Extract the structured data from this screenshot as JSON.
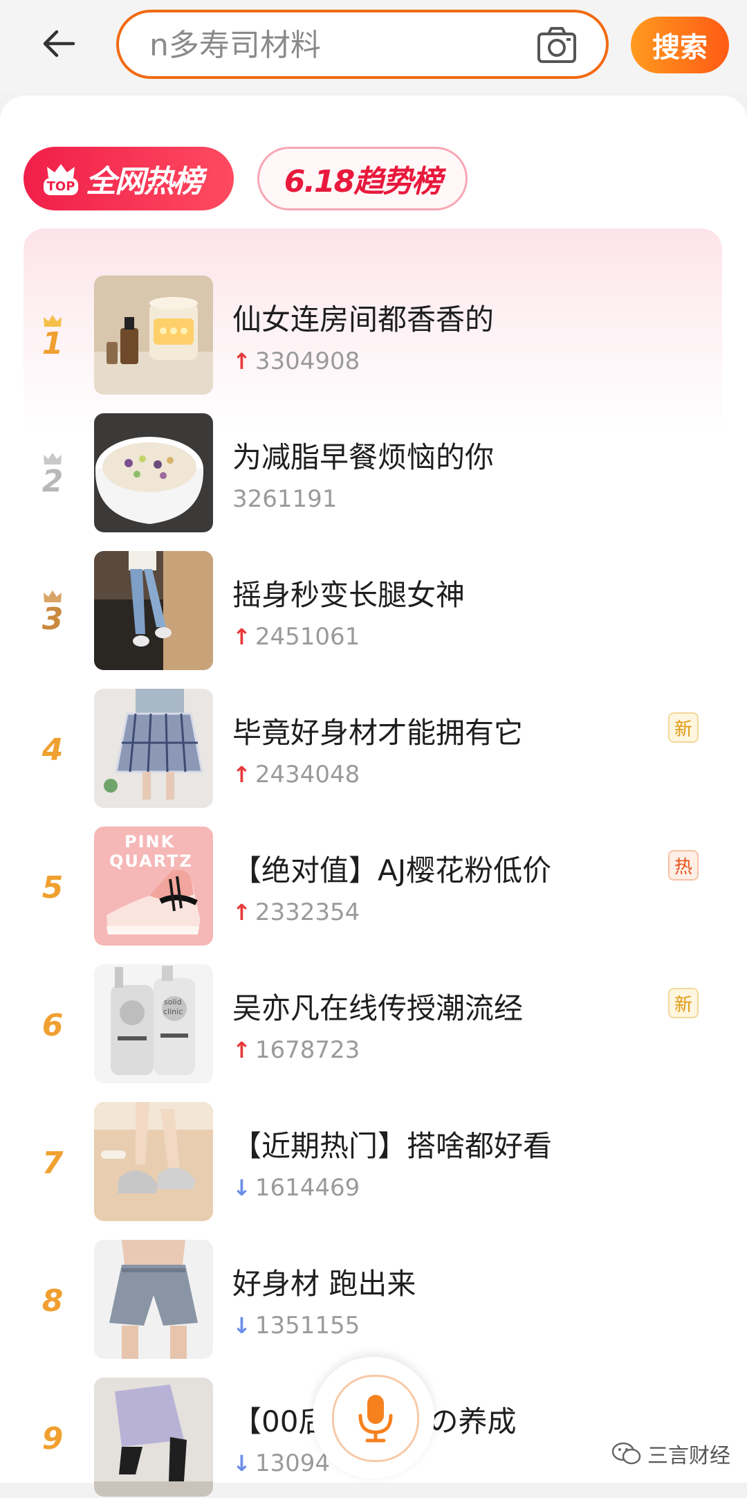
{
  "search": {
    "placeholder": "n多寿司材料",
    "button_label": "搜索"
  },
  "tabs": [
    {
      "label": "全网热榜",
      "badge": "TOP",
      "active": true
    },
    {
      "label": "6.18趋势榜",
      "active": false
    }
  ],
  "colors": {
    "accent": "#f26a12",
    "hot_tab": "#f01f4a",
    "rank_gold": "#f0a030",
    "rank_silver": "#b8b8b8",
    "rank_bronze": "#c9893e",
    "up_arrow": "#e83a3a",
    "down_arrow": "#6b8fe8"
  },
  "ranking": [
    {
      "rank": "1",
      "title": "仙女连房间都香香的",
      "count": "3304908",
      "trend": "up",
      "crown": true,
      "badge": ""
    },
    {
      "rank": "2",
      "title": "为减脂早餐烦恼的你",
      "count": "3261191",
      "trend": "none",
      "crown": true,
      "badge": ""
    },
    {
      "rank": "3",
      "title": "摇身秒变长腿女神",
      "count": "2451061",
      "trend": "up",
      "crown": true,
      "badge": ""
    },
    {
      "rank": "4",
      "title": "毕竟好身材才能拥有它",
      "count": "2434048",
      "trend": "up",
      "crown": false,
      "badge": "新"
    },
    {
      "rank": "5",
      "title": "【绝对值】AJ樱花粉低价",
      "count": "2332354",
      "trend": "up",
      "crown": false,
      "badge": "热"
    },
    {
      "rank": "6",
      "title": "吴亦凡在线传授潮流经",
      "count": "1678723",
      "trend": "up",
      "crown": false,
      "badge": "新"
    },
    {
      "rank": "7",
      "title": "【近期热门】搭啥都好看",
      "count": "1614469",
      "trend": "down",
      "crown": false,
      "badge": ""
    },
    {
      "rank": "8",
      "title": "好身材 跑出来",
      "count": "1351155",
      "trend": "down",
      "crown": false,
      "badge": ""
    },
    {
      "rank": "9",
      "title": "【00后】　　腿の养成",
      "count": "13094",
      "trend": "down",
      "crown": false,
      "badge": ""
    }
  ],
  "thumb_text": {
    "pink": "PINK",
    "quartz": "QUARTZ",
    "solid": "solid",
    "clinic": "clinic"
  },
  "watermark": "三言财经",
  "icons": {
    "back": "back-arrow-icon",
    "camera": "camera-icon",
    "mic": "microphone-icon",
    "wechat": "wechat-icon"
  }
}
